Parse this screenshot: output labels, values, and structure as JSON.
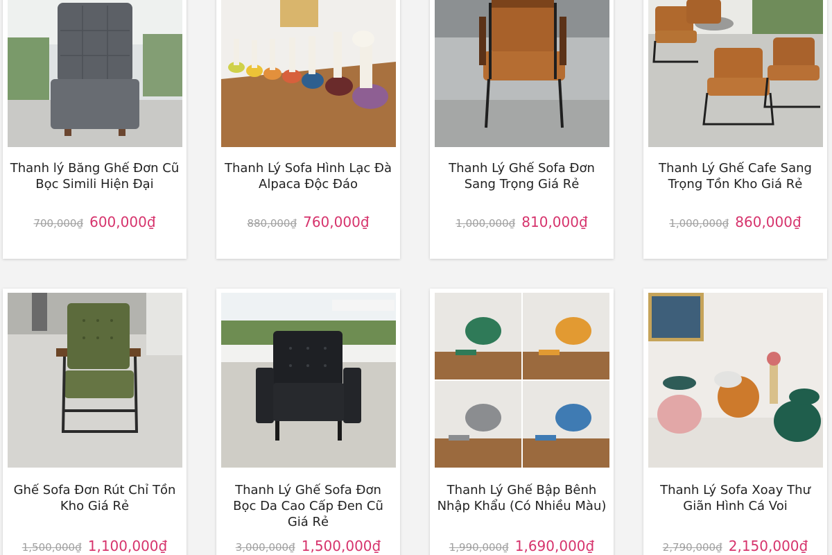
{
  "products": [
    {
      "title": "Thanh lý Băng Ghế Đơn Cũ Bọc Simili Hiện Đại",
      "old_price": "700,000₫",
      "new_price": "600,000₫",
      "image_icon": "grey-armless-sofa-chair-photo"
    },
    {
      "title": "Thanh Lý Sofa Hình Lạc Đà Alpaca Độc Đáo",
      "old_price": "880,000₫",
      "new_price": "760,000₫",
      "image_icon": "alpaca-stools-photo"
    },
    {
      "title": "Thanh Lý Ghế Sofa Đơn Sang Trọng Giá Rẻ",
      "old_price": "1,000,000₫",
      "new_price": "810,000₫",
      "image_icon": "brown-leather-armchair-photo"
    },
    {
      "title": "Thanh Lý Ghế Cafe Sang Trọng Tồn Kho Giá Rẻ",
      "old_price": "1,000,000₫",
      "new_price": "860,000₫",
      "image_icon": "cafe-chairs-set-photo"
    },
    {
      "title": "Ghế Sofa Đơn Rút Chỉ Tồn Kho Giá Rẻ",
      "old_price": "1,500,000₫",
      "new_price": "1,100,000₫",
      "image_icon": "green-tufted-chair-photo"
    },
    {
      "title": "Thanh Lý Ghế Sofa Đơn Bọc Da Cao Cấp Đen Cũ Giá Rẻ",
      "old_price": "3,000,000₫",
      "new_price": "1,500,000₫",
      "image_icon": "black-leather-sofa-photo"
    },
    {
      "title": "Thanh Lý Ghế Bập Bênh Nhập Khẩu (Có Nhiều Màu)",
      "old_price": "1,990,000₫",
      "new_price": "1,690,000₫",
      "image_icon": "rocking-chairs-grid-photo"
    },
    {
      "title": "Thanh Lý Sofa Xoay Thư Giãn Hình Cá Voi",
      "old_price": "2,790,000₫",
      "new_price": "2,150,000₫",
      "image_icon": "whale-swivel-chairs-photo"
    }
  ],
  "colors": {
    "old_price": "#a0a0a0",
    "new_price": "#d6336c",
    "card_background": "#ffffff",
    "page_background": "#f3f3f3"
  }
}
